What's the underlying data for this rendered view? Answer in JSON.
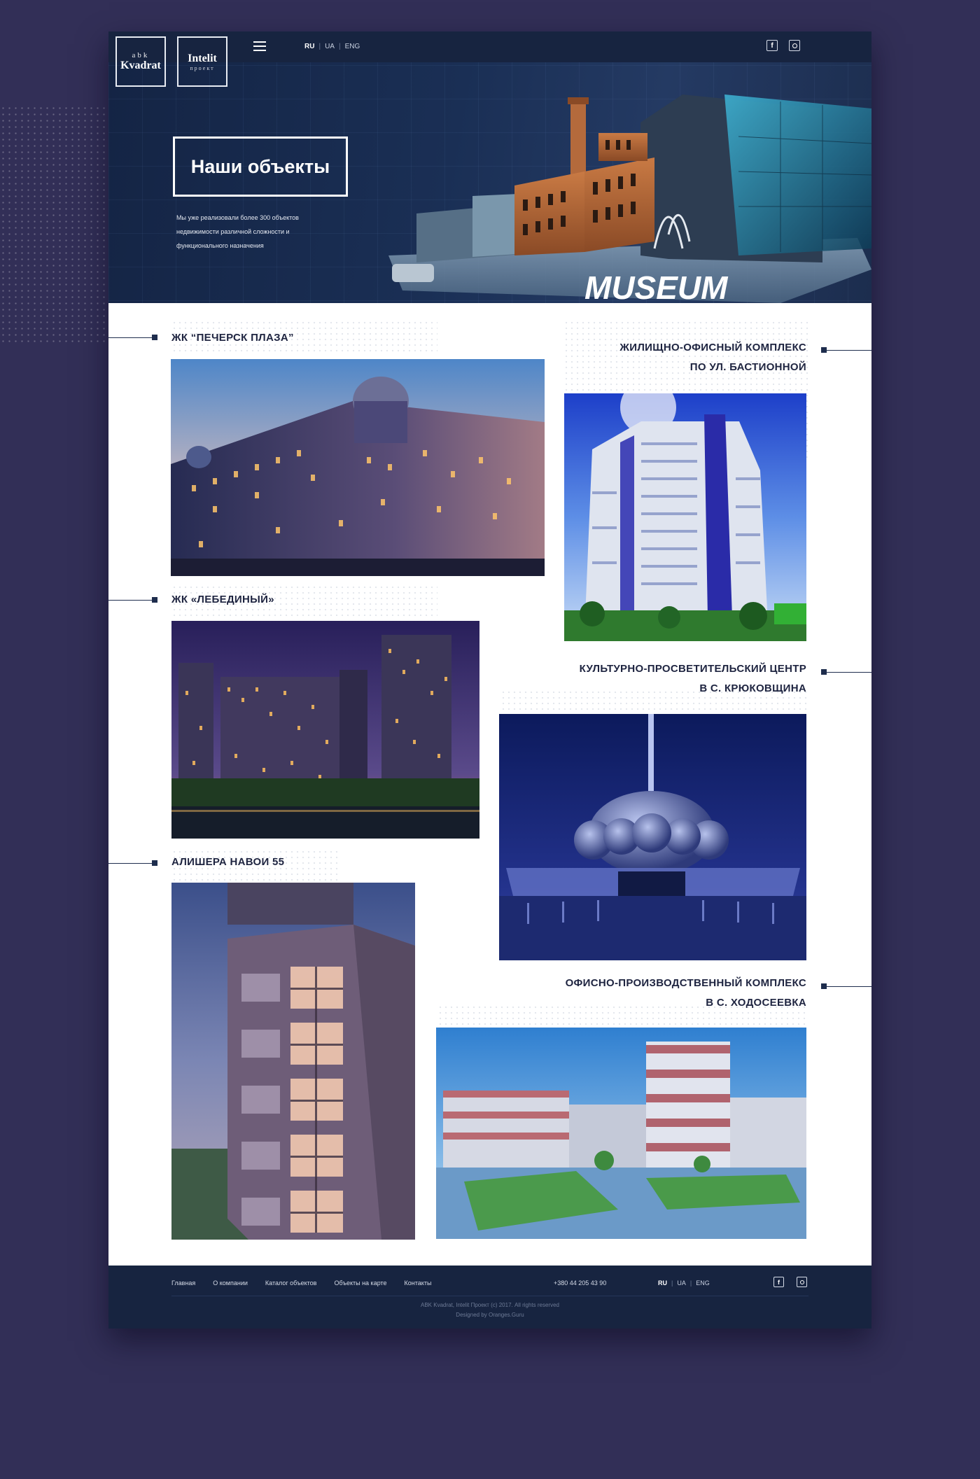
{
  "header": {
    "logo_kvadrat_small": "abk",
    "logo_kvadrat_main": "Kvadrat",
    "logo_intelit_main": "Intelit",
    "logo_intelit_sub": "проект",
    "languages": [
      "RU",
      "UA",
      "ENG"
    ],
    "active_language": "RU",
    "social": {
      "facebook": "f"
    }
  },
  "hero": {
    "title": "Наши объекты",
    "description_lines": [
      "Мы уже реализовали более 300 объектов",
      "недвижимости различной сложности и",
      "функционального назначения"
    ],
    "museum_sign": "MUSEUM"
  },
  "objects": [
    {
      "title": "ЖК “ПЕЧЕРСК ПЛАЗА”"
    },
    {
      "title_line1": "ЖИЛИЩНО-ОФИСНЫЙ КОМПЛЕКС",
      "title_line2": "ПО УЛ. БАСТИОННОЙ"
    },
    {
      "title": "ЖК «ЛЕБЕДИНЫЙ»"
    },
    {
      "title_line1": "КУЛЬТУРНО-ПРОСВЕТИТЕЛЬСКИЙ ЦЕНТР",
      "title_line2": "В С. КРЮКОВЩИНА"
    },
    {
      "title": "АЛИШЕРА НАВОИ 55"
    },
    {
      "title_line1": "ОФИСНО-ПРОИЗВОДСТВЕННЫЙ КОМПЛЕКС",
      "title_line2": "В С. ХОДОСЕЕВКА"
    }
  ],
  "footer": {
    "nav": [
      "Главная",
      "О компании",
      "Каталог объектов",
      "Объекты на карте",
      "Контакты"
    ],
    "phone": "+380 44 205 43 90",
    "languages": [
      "RU",
      "UA",
      "ENG"
    ],
    "facebook": "f",
    "copyright": "ABK Kvadrat, Intelit Проект (с) 2017. All rights reserved",
    "designed_by": "Designed by Oranges.Guru"
  }
}
